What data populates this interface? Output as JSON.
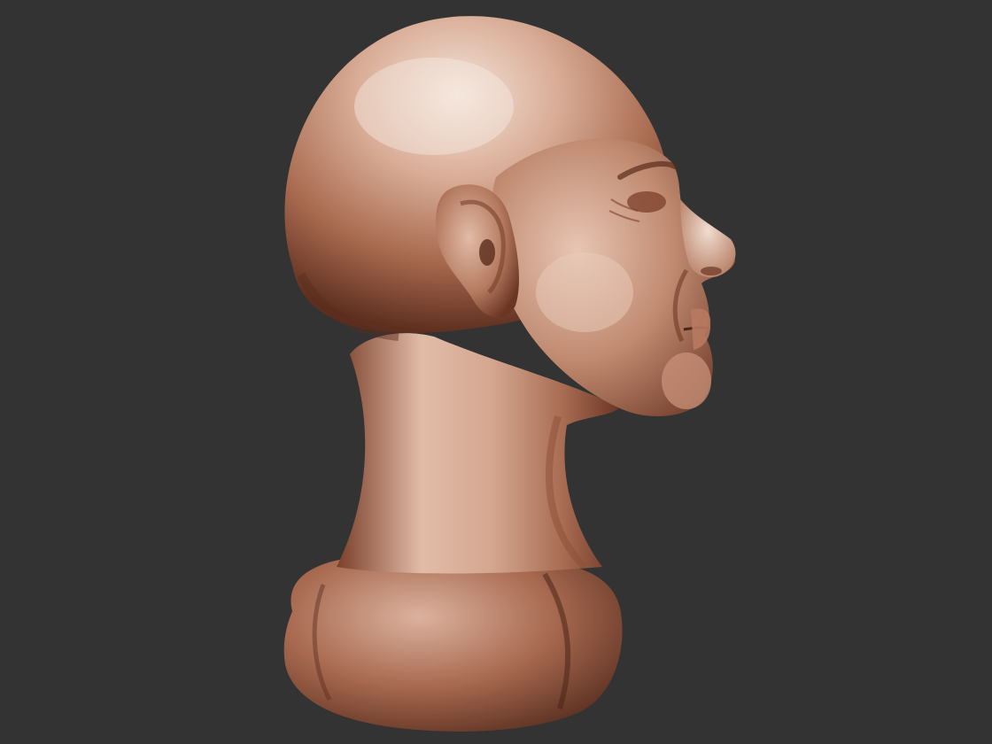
{
  "scene": {
    "subject": "sculpted-bust-profile",
    "colors": {
      "background": "#333333",
      "clay_light": "#e8c6b4",
      "clay_mid": "#b67a5e",
      "clay_dark": "#6e3a26",
      "clay_shadow": "#4a2418",
      "highlight": "#f3e2d8"
    }
  }
}
